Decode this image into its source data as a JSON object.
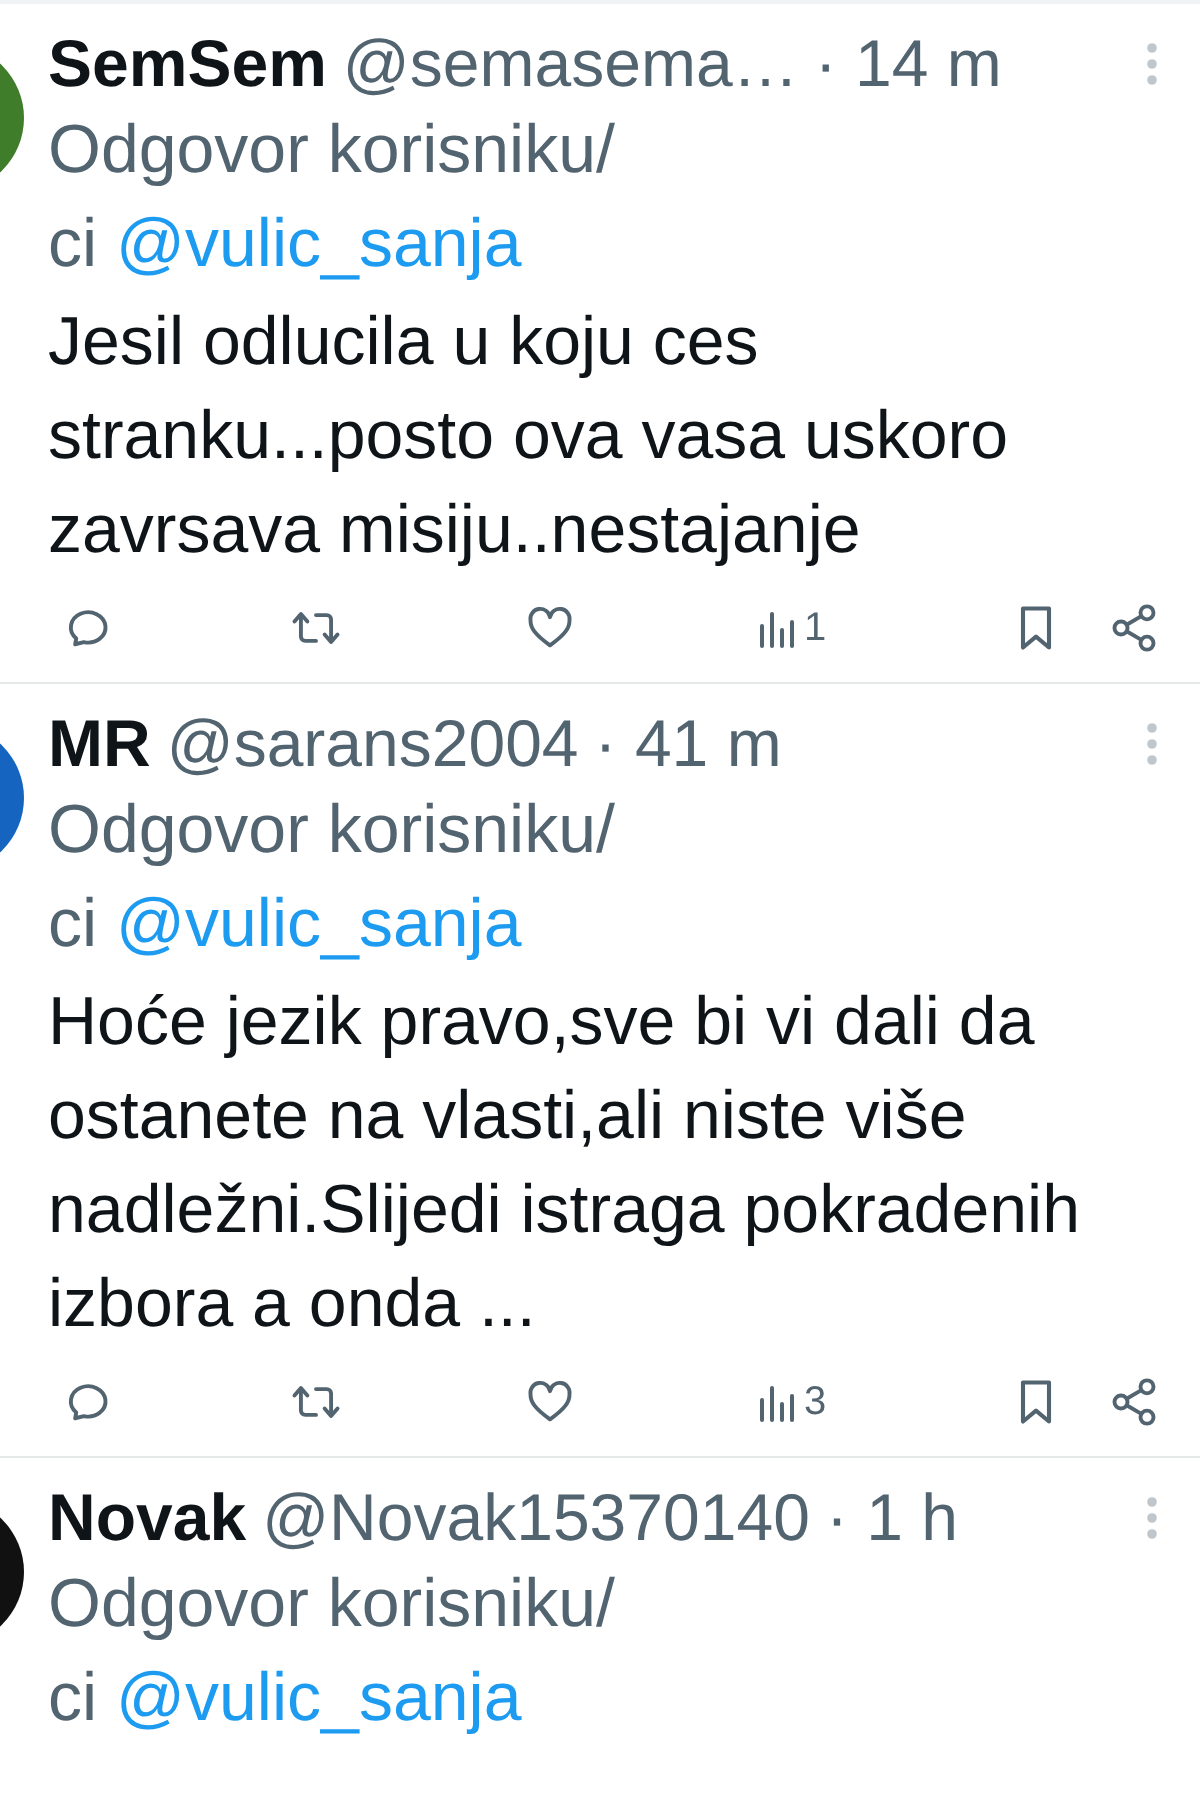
{
  "tweets": [
    {
      "name": "SemSem",
      "handle": "@semasema…",
      "time": "· 14 m",
      "color": "#3f7d2a",
      "reply_line": "Odgovor korisniku/",
      "reply_line_2": "ci",
      "mention": "@vulic_sanja",
      "text": "Jesil odlucila u koju ces stranku...posto ova vasa uskoro zavrsava misiju..nestajanje",
      "views": "1"
    },
    {
      "name": "MR",
      "handle": "@sarans2004",
      "time": "· 41 m",
      "color": "#1565c0",
      "reply_line": "Odgovor korisniku/",
      "reply_line_2": "ci",
      "mention": "@vulic_sanja",
      "text": "Hoće jezik pravo,sve bi vi dali da ostanete na vlasti,ali niste više nadležni.Slijedi istraga pokradenih izbora a onda ...",
      "views": "3"
    },
    {
      "name": "Novak",
      "handle": "@Novak15370140",
      "time": "· 1 h",
      "color": "#111111",
      "reply_line": "Odgovor korisniku/",
      "reply_line_2": "ci",
      "mention": "@vulic_sanja"
    }
  ]
}
